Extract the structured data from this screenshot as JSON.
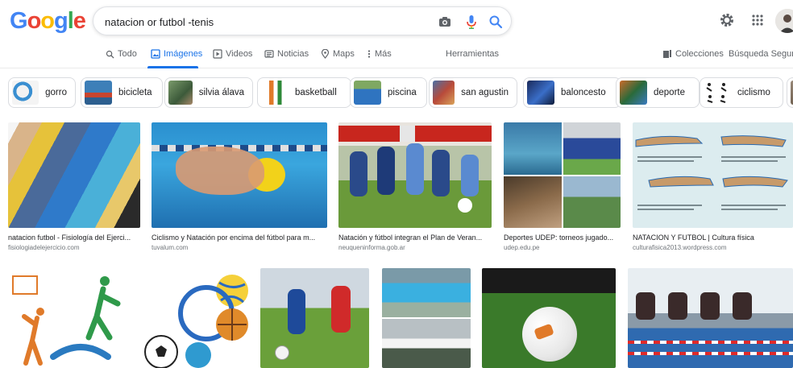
{
  "logo": {
    "letters": [
      "G",
      "o",
      "o",
      "g",
      "l",
      "e"
    ]
  },
  "search": {
    "query": "natacion or futbol -tenis"
  },
  "tabs": [
    {
      "label": "Todo",
      "icon": "search-icon"
    },
    {
      "label": "Imágenes",
      "icon": "image-icon",
      "active": true
    },
    {
      "label": "Videos",
      "icon": "video-icon"
    },
    {
      "label": "Noticias",
      "icon": "news-icon"
    },
    {
      "label": "Maps",
      "icon": "map-pin-icon"
    },
    {
      "label": "Más",
      "icon": "more-vert-icon"
    },
    {
      "label": "Herramientas"
    },
    {
      "label": "Colecciones",
      "icon": "collections-icon"
    },
    {
      "label": "Búsqueda Segura"
    }
  ],
  "chips": [
    {
      "label": "gorro"
    },
    {
      "label": "bicicleta"
    },
    {
      "label": "silvia álava"
    },
    {
      "label": "basketball"
    },
    {
      "label": "piscina"
    },
    {
      "label": "san agustin"
    },
    {
      "label": "baloncesto"
    },
    {
      "label": "deporte"
    },
    {
      "label": "ciclismo"
    }
  ],
  "results": [
    {
      "title": "natacion futbol - Fisiología del Ejerci...",
      "site": "fisiologiadelejercicio.com"
    },
    {
      "title": "Ciclismo y Natación por encima del fútbol para m...",
      "site": "tuvalum.com"
    },
    {
      "title": "Natación y fútbol integran el Plan de Veran...",
      "site": "neuqueninforma.gob.ar"
    },
    {
      "title": "Deportes UDEP: torneos jugado...",
      "site": "udep.edu.pe"
    },
    {
      "title": "NATACION Y FUTBOL | Cultura física",
      "site": "culturafisica2013.wordpress.com"
    }
  ],
  "colors": {
    "google_blue": "#4285f4",
    "google_red": "#ea4335",
    "google_yellow": "#fbbc05",
    "google_green": "#34a853",
    "active_tab": "#1a73e8"
  }
}
